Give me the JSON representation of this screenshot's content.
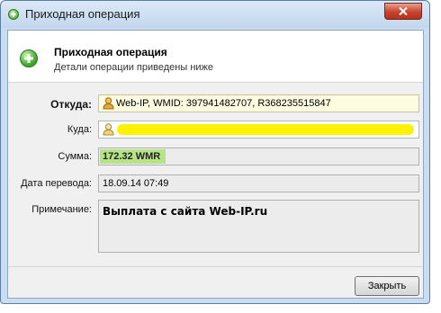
{
  "window": {
    "title": "Приходная операция",
    "icon": "plus-circle-icon",
    "close_icon": "close-icon"
  },
  "header": {
    "title": "Приходная операция",
    "subtitle": "Детали операции приведены ниже",
    "icon": "plus-circle-icon"
  },
  "fields": {
    "from_label": "Откуда:",
    "from_value": "Web-IP, WMID: 397941482707, R368235515847",
    "to_label": "Куда:",
    "to_value": "",
    "amount_label": "Сумма:",
    "amount_value": "172.32 WMR",
    "date_label": "Дата перевода:",
    "date_value": "18.09.14 07:49",
    "note_label": "Примечание:",
    "note_value": "Выплата с сайта Web-IP.ru"
  },
  "footer": {
    "close_button": "Закрыть"
  },
  "colors": {
    "accent_green": "#45ad2f",
    "amount_highlight": "#b7e387",
    "redaction_yellow": "#fff200",
    "window_frame": "#c9dcf0"
  }
}
